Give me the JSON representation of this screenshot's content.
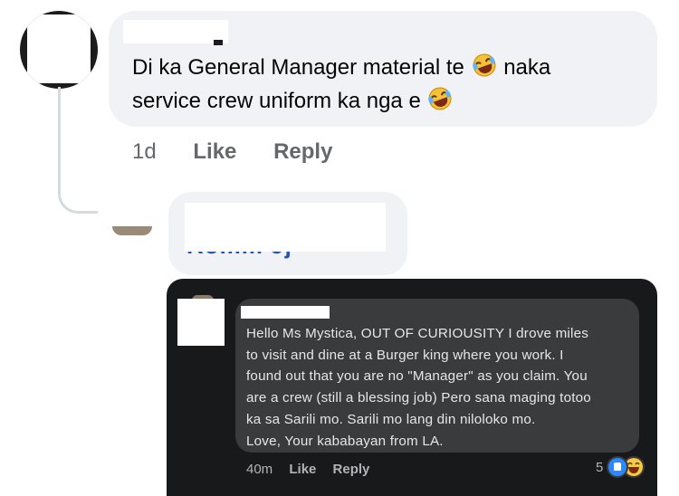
{
  "comment_1": {
    "text_line_1": "Di ka General Manager material te",
    "text_line_1_after": "naka",
    "text_line_2": "service crew uniform ka nga e",
    "emoji": "rolling-on-floor-laughing",
    "timestamp": "1d",
    "like_label": "Like",
    "reply_label": "Reply"
  },
  "reply_1": {
    "author_fragment": "Romm Jj"
  },
  "embedded": {
    "comment_lines": [
      "Hello Ms Mystica, OUT OF CURIOUSITY I drove miles",
      "to visit and dine at a Burger king where you work. I",
      "found out that you are no \"Manager\" as you claim. You",
      "are a crew (still a blessing job) Pero sana maging totoo",
      "ka sa Sarili mo. Sarili mo lang din niloloko mo.",
      "Love, Your kababayan from LA."
    ],
    "timestamp": "40m",
    "like_label": "Like",
    "reply_label": "Reply",
    "reaction_count": "5",
    "reactions": [
      "like-icon",
      "laugh-icon"
    ]
  },
  "colors": {
    "light_bubble": "#f0f2f5",
    "dark_bg": "#18191a",
    "dark_bubble": "#3a3b3c",
    "link_blue": "#2353b8",
    "like_blue": "#2d88ff"
  }
}
